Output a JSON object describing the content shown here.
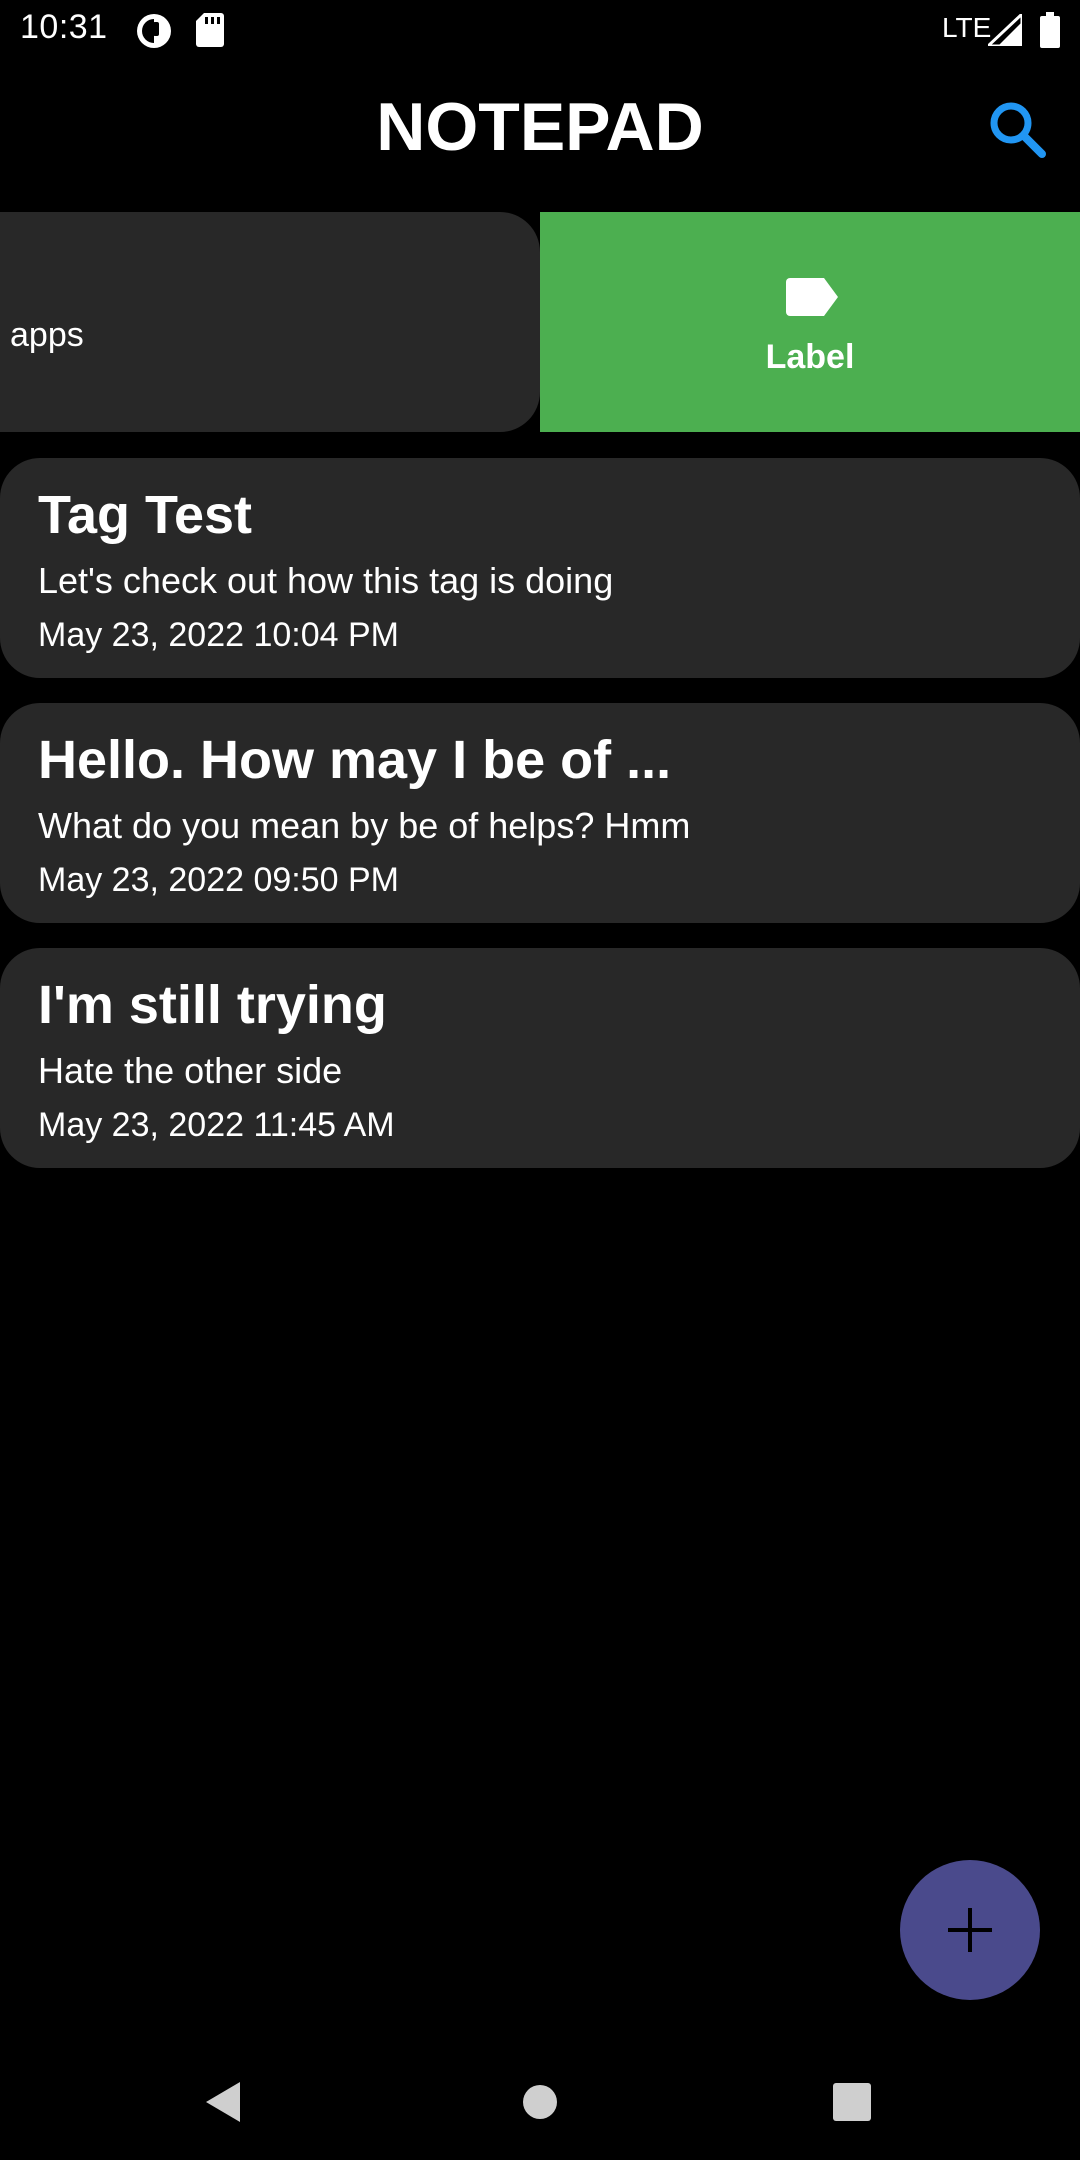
{
  "status_bar": {
    "time": "10:31",
    "network": "LTE"
  },
  "app_bar": {
    "title": "NOTEPAD",
    "search_icon": "search-icon",
    "accent_color": "#2196f3"
  },
  "swiped_note": {
    "visible_text": "apps",
    "action_label": "Label",
    "action_icon": "label-icon",
    "action_color": "#4caf50"
  },
  "notes": [
    {
      "title": "Tag Test",
      "body": "Let's check out how this tag is doing",
      "date": "May 23, 2022 10:04 PM"
    },
    {
      "title": "Hello. How may I be of ...",
      "body": "What do you mean by be of helps? Hmm",
      "date": "May 23, 2022 09:50 PM"
    },
    {
      "title": "I'm still trying",
      "body": "Hate the other side",
      "date": "May 23, 2022 11:45 AM"
    }
  ],
  "fab": {
    "icon": "plus-icon",
    "color": "#4a4a8c"
  },
  "nav_bar": {
    "back_icon": "back-icon",
    "home_icon": "home-icon",
    "recents_icon": "recents-icon"
  }
}
